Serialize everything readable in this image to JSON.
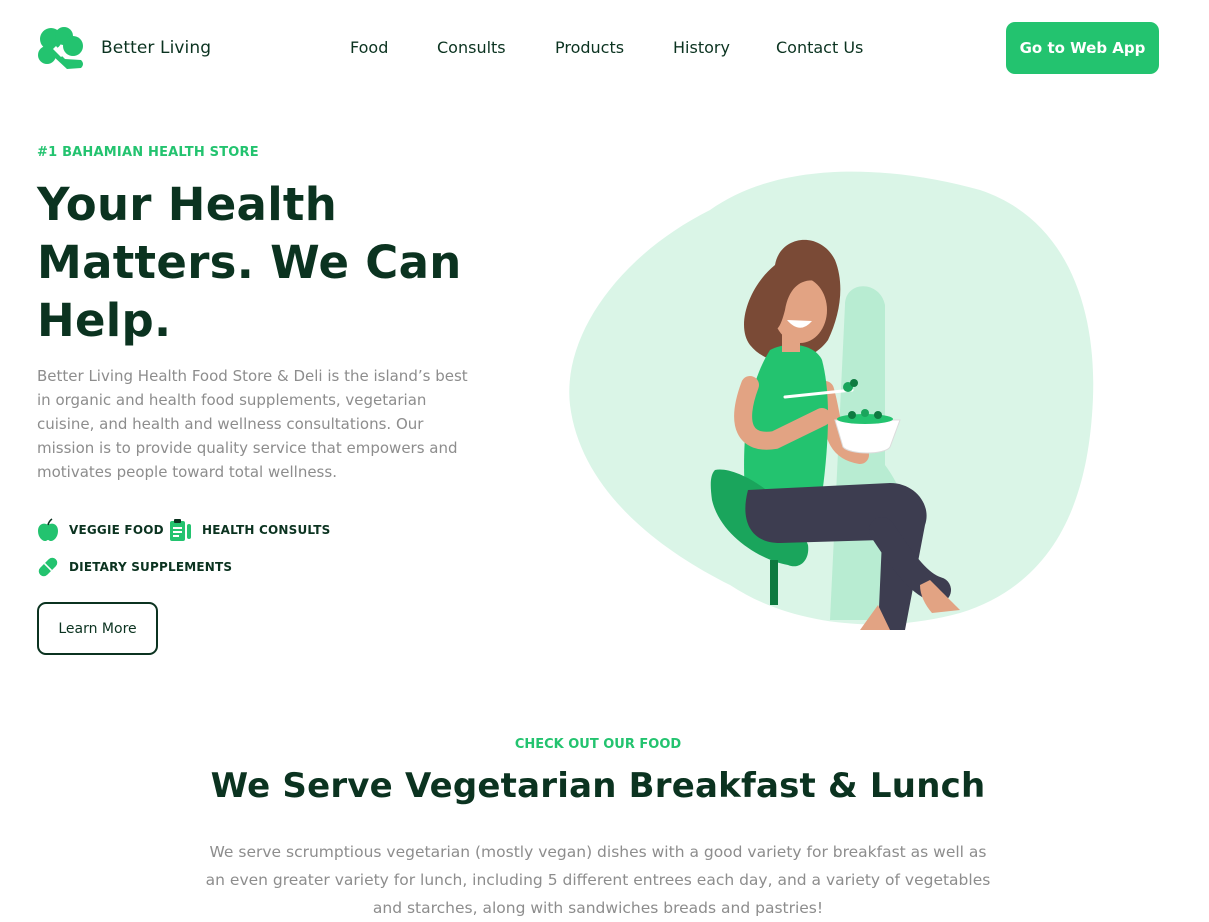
{
  "brand": {
    "name": "Better Living",
    "logo_icon": "broccoli-icon",
    "accent": "#23c36f",
    "dark": "#0b3320"
  },
  "nav": {
    "items": [
      {
        "label": "Food"
      },
      {
        "label": "Consults"
      },
      {
        "label": "Products"
      },
      {
        "label": "History"
      },
      {
        "label": "Contact Us"
      }
    ],
    "cta_label": "Go to Web App"
  },
  "hero": {
    "eyebrow": "#1 BAHAMIAN HEALTH STORE",
    "headline": "Your Health Matters. We Can Help.",
    "description": "Better Living Health Food Store & Deli is the island’s best in organic and health food supplements, vegetarian cuisine, and health and wellness consultations. Our mission is to provide quality service that empowers and motivates people toward total wellness.",
    "features": [
      {
        "icon": "apple-icon",
        "label": "VEGGIE FOOD"
      },
      {
        "icon": "clipboard-icon",
        "label": "HEALTH CONSULTS"
      },
      {
        "icon": "pill-icon",
        "label": "DIETARY SUPPLEMENTS"
      }
    ],
    "button_label": "Learn More",
    "illustration": "woman-eating-salad-illustration"
  },
  "food_section": {
    "eyebrow": "CHECK OUT OUR FOOD",
    "title": "We Serve Vegetarian Breakfast & Lunch",
    "description": "We serve scrumptious vegetarian (mostly vegan) dishes with a good variety for breakfast as well as an even greater variety for lunch, including 5 different entrees each day, and a variety of vegetables and starches, along with sandwiches breads and pastries!"
  }
}
